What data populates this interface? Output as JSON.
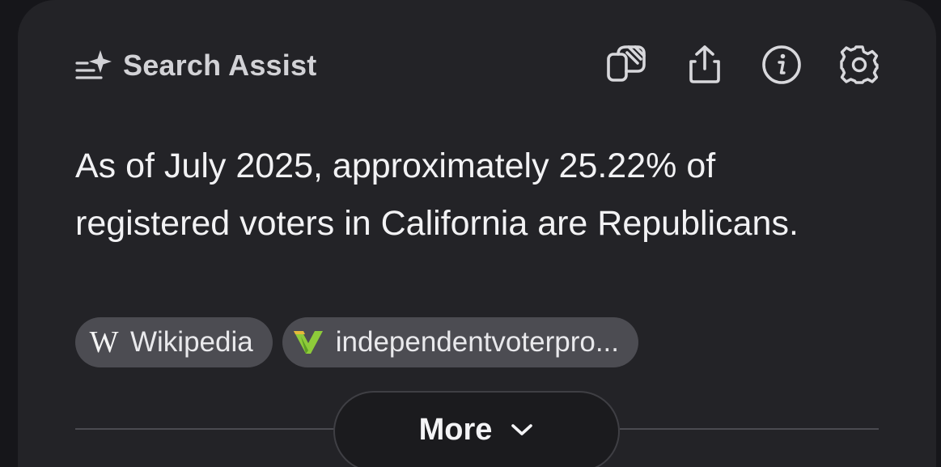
{
  "header": {
    "title": "Search Assist",
    "icons": [
      "sparkle-list-icon",
      "copy-icon",
      "share-icon",
      "info-icon",
      "settings-icon"
    ]
  },
  "answer": {
    "text": "As of July 2025, approximately 25.22% of registered voters in California are Republicans."
  },
  "sources": [
    {
      "label": "Wikipedia",
      "icon": "wikipedia-icon"
    },
    {
      "label": "independentvoterpro...",
      "icon": "independent-voter-logo-icon"
    }
  ],
  "more_button": {
    "label": "More",
    "icon": "chevron-down-icon"
  },
  "colors": {
    "page_background": "#16161a",
    "card_background": "#232327",
    "chip_background": "#4c4c52",
    "text_primary": "#f2f2f4",
    "text_secondary": "#d2d2d6",
    "logo_green": "#8ecb3a",
    "logo_yellow": "#e6b93a"
  }
}
